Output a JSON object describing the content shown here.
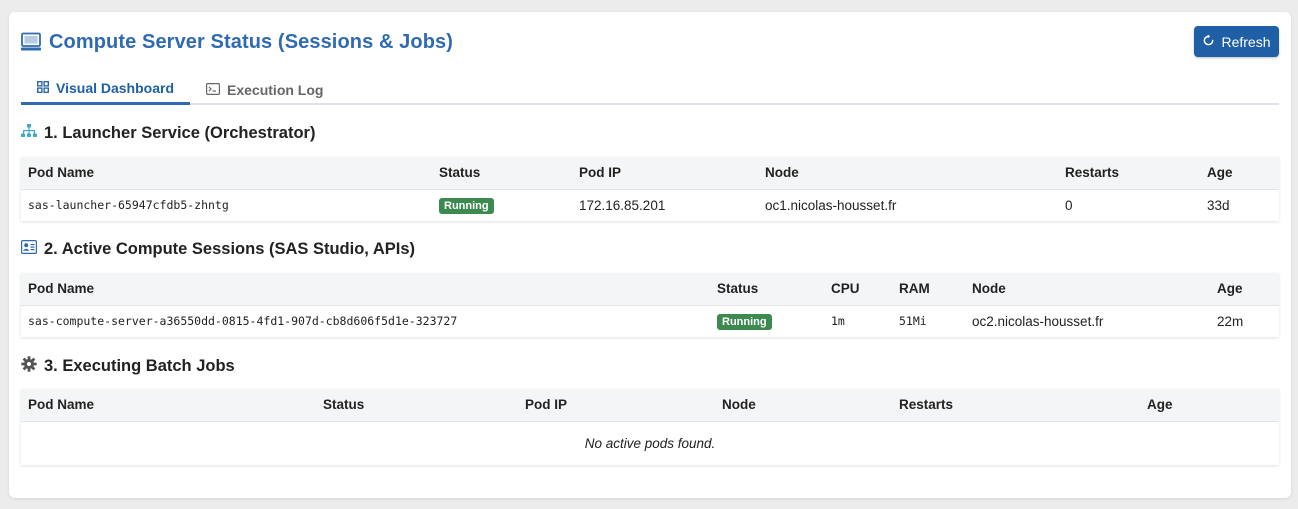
{
  "header": {
    "title": "Compute Server Status (Sessions & Jobs)",
    "refresh_label": "Refresh"
  },
  "tabs": [
    {
      "label": "Visual Dashboard",
      "icon": "grid-icon",
      "active": true
    },
    {
      "label": "Execution Log",
      "icon": "terminal-icon",
      "active": false
    }
  ],
  "launcher": {
    "title": "1. Launcher Service (Orchestrator)",
    "icon": "sitemap-icon",
    "columns": [
      "Pod Name",
      "Status",
      "Pod IP",
      "Node",
      "Restarts",
      "Age"
    ],
    "rows": [
      {
        "pod": "sas-launcher-65947cfdb5-zhntg",
        "status": "Running",
        "ip": "172.16.85.201",
        "node": "oc1.nicolas-housset.fr",
        "restarts": "0",
        "age": "33d"
      }
    ]
  },
  "sessions": {
    "title": "2. Active Compute Sessions (SAS Studio, APIs)",
    "icon": "id-card-icon",
    "columns": [
      "Pod Name",
      "Status",
      "CPU",
      "RAM",
      "Node",
      "Age"
    ],
    "rows": [
      {
        "pod": "sas-compute-server-a36550dd-0815-4fd1-907d-cb8d606f5d1e-323727",
        "status": "Running",
        "cpu": "1m",
        "ram": "51Mi",
        "node": "oc2.nicolas-housset.fr",
        "age": "22m"
      }
    ]
  },
  "batch": {
    "title": "3. Executing Batch Jobs",
    "icon": "gear-icon",
    "columns": [
      "Pod Name",
      "Status",
      "Pod IP",
      "Node",
      "Restarts",
      "Age"
    ],
    "empty_message": "No active pods found."
  },
  "colors": {
    "accent": "#2f6bb3",
    "button": "#1f5fa6",
    "running": "#3d8a50"
  }
}
